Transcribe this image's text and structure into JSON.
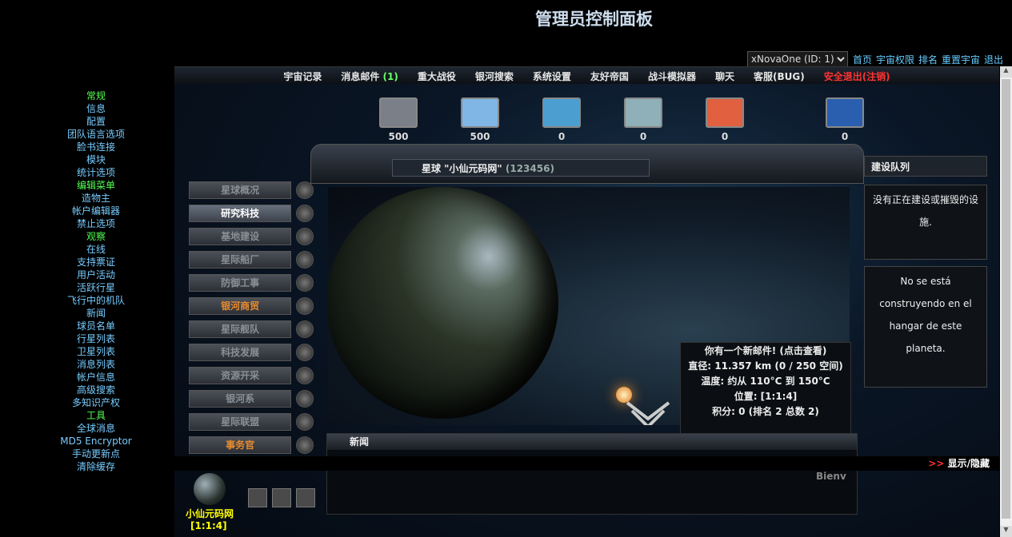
{
  "page_title": "管理员控制面板",
  "topright": {
    "select_value": "xNovaOne (ID: 1)",
    "links": [
      "首页",
      "宇宙权限",
      "排名",
      "重置宇宙",
      "退出"
    ]
  },
  "topbar": {
    "items": [
      "宇宙记录",
      "消息邮件",
      "重大战役",
      "银河搜索",
      "系统设置",
      "友好帝国",
      "战斗模拟器",
      "聊天",
      "客服(BUG)"
    ],
    "mail_count": "(1)",
    "logout": "安全退出(注销)"
  },
  "sidebar": {
    "items": [
      {
        "label": "常规",
        "green": true
      },
      {
        "label": "信息",
        "green": false
      },
      {
        "label": "配置",
        "green": false
      },
      {
        "label": "团队语言选项",
        "green": false
      },
      {
        "label": "脸书连接",
        "green": false
      },
      {
        "label": "模块",
        "green": false
      },
      {
        "label": "统计选项",
        "green": false
      },
      {
        "label": "编辑菜单",
        "green": true
      },
      {
        "label": "造物主",
        "green": false
      },
      {
        "label": "帐户编辑器",
        "green": false
      },
      {
        "label": "禁止选项",
        "green": false
      },
      {
        "label": "观察",
        "green": true
      },
      {
        "label": "在线",
        "green": false
      },
      {
        "label": "支持票证",
        "green": false
      },
      {
        "label": "用户活动",
        "green": false
      },
      {
        "label": "活跃行星",
        "green": false
      },
      {
        "label": "飞行中的机队",
        "green": false
      },
      {
        "label": "新闻",
        "green": false
      },
      {
        "label": "球员名单",
        "green": false
      },
      {
        "label": "行星列表",
        "green": false
      },
      {
        "label": "卫星列表",
        "green": false
      },
      {
        "label": "消息列表",
        "green": false
      },
      {
        "label": "帐户信息",
        "green": false
      },
      {
        "label": "高级搜索",
        "green": false
      },
      {
        "label": "多知识产权",
        "green": false
      },
      {
        "label": "工具",
        "green": true
      },
      {
        "label": "全球消息",
        "green": false
      },
      {
        "label": "MD5 Encryptor",
        "green": false
      },
      {
        "label": "手动更新点",
        "green": false
      },
      {
        "label": "清除缓存",
        "green": false
      }
    ]
  },
  "resources": [
    {
      "value": "500",
      "color": "#7a7f88"
    },
    {
      "value": "500",
      "color": "#7fb6e6"
    },
    {
      "value": "0",
      "color": "#4a9fd0"
    },
    {
      "value": "0",
      "color": "#8fb0b8"
    },
    {
      "value": "0",
      "color": "#e06040"
    },
    {
      "value": "0",
      "color": "#2a5fb0"
    }
  ],
  "planet": {
    "label": "星球 \"小仙元码网\"",
    "code": "(123456)"
  },
  "menu": [
    {
      "label": "星球概况",
      "state": "normal"
    },
    {
      "label": "研究科技",
      "state": "active"
    },
    {
      "label": "基地建设",
      "state": "normal"
    },
    {
      "label": "星际船厂",
      "state": "normal"
    },
    {
      "label": "防御工事",
      "state": "normal"
    },
    {
      "label": "银河商贸",
      "state": "orange"
    },
    {
      "label": "星际舰队",
      "state": "normal"
    },
    {
      "label": "科技发展",
      "state": "normal"
    },
    {
      "label": "资源开采",
      "state": "normal"
    },
    {
      "label": "银河系",
      "state": "normal"
    },
    {
      "label": "星际联盟",
      "state": "normal"
    },
    {
      "label": "事务官",
      "state": "orange"
    }
  ],
  "info": {
    "mail_notice": "你有一个新邮件! (点击查看)",
    "diameter": "直径: 11.357 km (0 / 250 空间)",
    "temperature": "温度: 约从 110°C 到 150°C",
    "position": "位置: [1:1:4]",
    "score": "积分: 0 (排名 2 总数 2)"
  },
  "news": {
    "title": "新闻",
    "text": "Bienv"
  },
  "build_queue": {
    "title": "建设队列",
    "empty": "没有正在建设或摧毁的设施.",
    "hangar": "No se está construyendo en el hangar de este planeta."
  },
  "toggle": {
    "arrows": ">>",
    "label": "显示/隐藏"
  },
  "player": {
    "name": "小仙元码网",
    "coords": "[1:1:4]"
  }
}
